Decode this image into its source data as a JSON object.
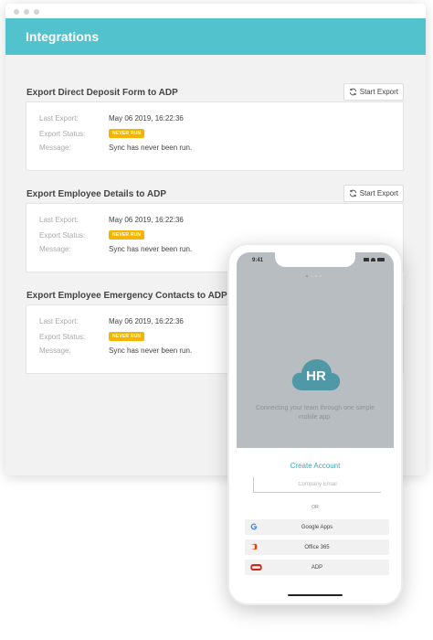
{
  "window": {
    "title": "Integrations"
  },
  "export_button_label": "Start Export",
  "field_labels": {
    "last_export": "Last Export:",
    "export_status": "Export Status:",
    "message": "Message:"
  },
  "sections": [
    {
      "title": "Export Direct Deposit Form to ADP",
      "last_export": "May 06 2019, 16:22:36",
      "status": "NEVER RUN",
      "message": "Sync has never been run."
    },
    {
      "title": "Export Employee Details to ADP",
      "last_export": "May 06 2019, 16:22:36",
      "status": "NEVER RUN",
      "message": "Sync has never been run."
    },
    {
      "title": "Export Employee Emergency Contacts to ADP",
      "last_export": "May 06 2019, 16:22:36",
      "status": "NEVER RUN",
      "message": "Sync has never been run."
    }
  ],
  "status_color": "#f4b400",
  "accent_color": "#52c2cc",
  "phone": {
    "time": "9:41",
    "logo_text": "HR",
    "tagline": "Connecting your team through one simple mobile app.",
    "create_account": "Create Account",
    "email_placeholder": "Company Email",
    "or": "OR",
    "sso_buttons": [
      {
        "label": "Google Apps",
        "icon": "google-icon"
      },
      {
        "label": "Office 365",
        "icon": "office365-icon"
      },
      {
        "label": "ADP",
        "icon": "adp-icon"
      }
    ]
  }
}
